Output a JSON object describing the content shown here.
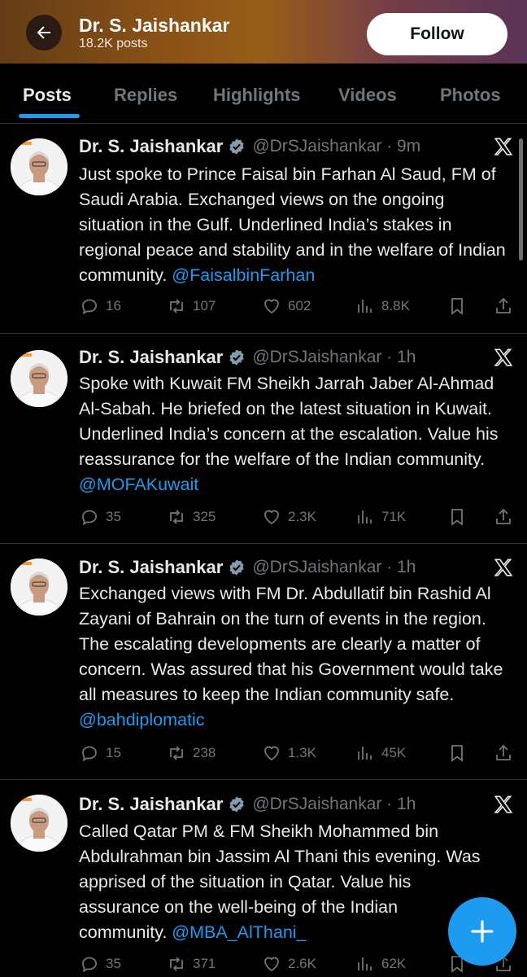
{
  "header": {
    "name": "Dr. S. Jaishankar",
    "posts": "18.2K posts",
    "follow_label": "Follow"
  },
  "tabs": [
    {
      "label": "Posts",
      "active": true
    },
    {
      "label": "Replies"
    },
    {
      "label": "Highlights"
    },
    {
      "label": "Videos"
    },
    {
      "label": "Photos"
    }
  ],
  "tweets": [
    {
      "name": "Dr. S. Jaishankar",
      "handle_time": "@DrSJaishankar · 9m",
      "text": "Just spoke to Prince Faisal bin Farhan Al Saud, FM of Saudi Arabia. Exchanged views on the ongoing situation in the Gulf. Underlined India’s stakes in regional peace and stability and in the welfare of Indian community. ",
      "mention": "@FaisalbinFarhan",
      "replies": "16",
      "reposts": "107",
      "likes": "602",
      "views": "8.8K"
    },
    {
      "name": "Dr. S. Jaishankar",
      "handle_time": "@DrSJaishankar · 1h",
      "text": "Spoke with Kuwait FM Sheikh Jarrah Jaber Al-Ahmad Al-Sabah. He briefed on the latest situation in Kuwait. Underlined India’s concern at the escalation. Value his reassurance for the welfare of the Indian community. ",
      "mention": "@MOFAKuwait",
      "replies": "35",
      "reposts": "325",
      "likes": "2.3K",
      "views": "71K"
    },
    {
      "name": "Dr. S. Jaishankar",
      "handle_time": "@DrSJaishankar · 1h",
      "text": "Exchanged views with FM Dr. Abdullatif bin Rashid Al Zayani of Bahrain on the turn of events in the region. The escalating developments are clearly a matter of concern. Was assured that his Government would take all measures to keep the Indian community safe. ",
      "mention": "@bahdiplomatic",
      "replies": "15",
      "reposts": "238",
      "likes": "1.3K",
      "views": "45K"
    },
    {
      "name": "Dr. S. Jaishankar",
      "handle_time": "@DrSJaishankar · 1h",
      "text": "Called Qatar PM & FM Sheikh Mohammed bin Abdulrahman bin Jassim Al Thani this evening. Was apprised of the situation in Qatar. Value his assurance on the well-being of the Indian community. ",
      "mention": "@MBA_AlThani_",
      "replies": "35",
      "reposts": "371",
      "likes": "2.6K",
      "views": "62K"
    }
  ],
  "colors": {
    "accent": "#1d9bf0",
    "muted": "#71767b",
    "background": "#000000"
  },
  "icons": [
    "back-arrow-icon",
    "verified-badge-icon",
    "x-logo-icon",
    "reply-icon",
    "repost-icon",
    "like-icon",
    "views-icon",
    "bookmark-icon",
    "share-icon",
    "compose-plus-icon"
  ]
}
